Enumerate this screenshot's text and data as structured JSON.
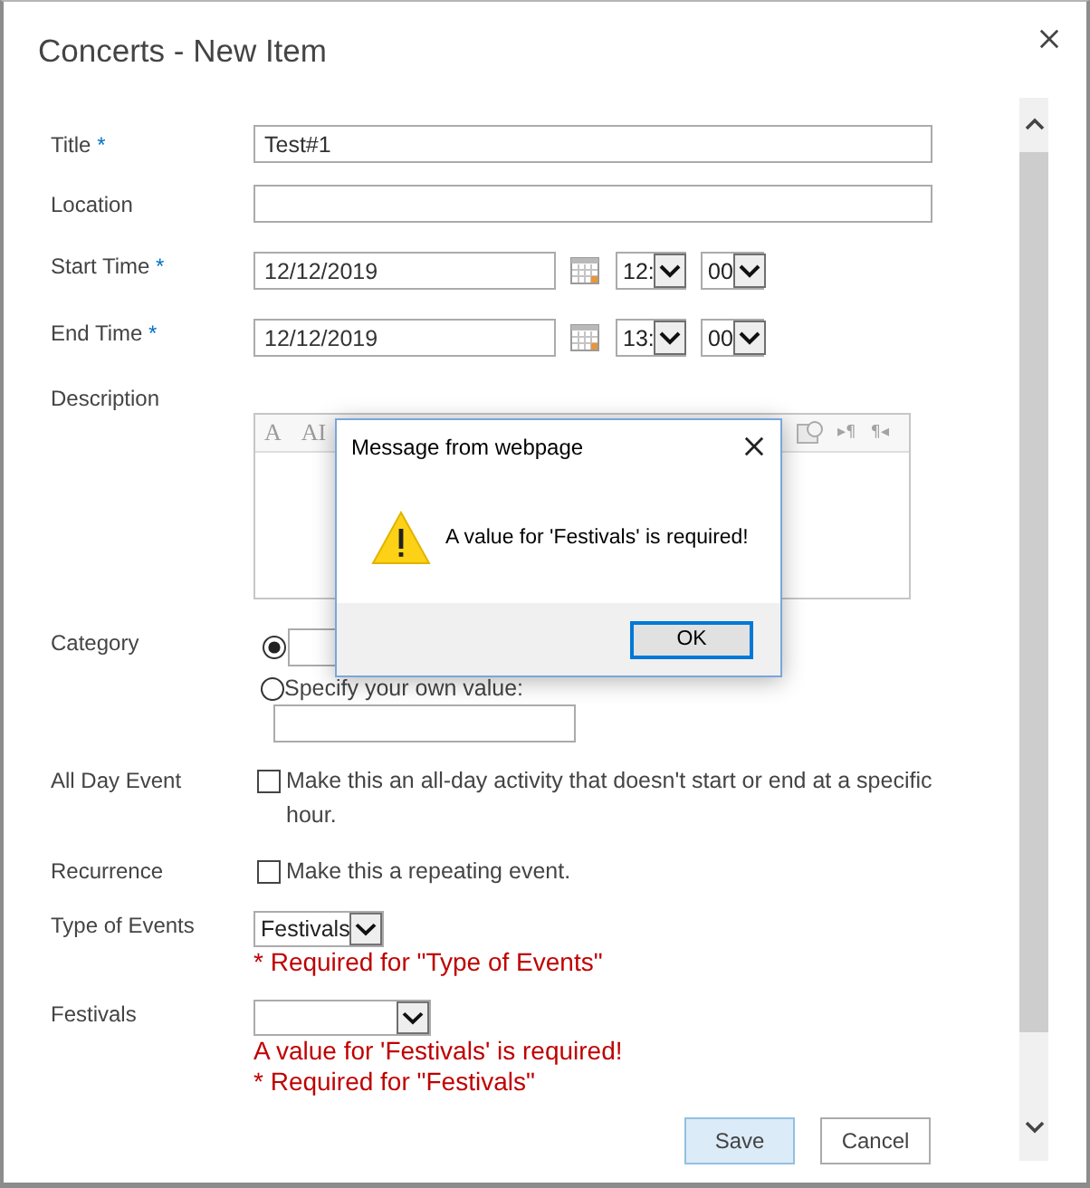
{
  "window": {
    "title": "Concerts - New Item"
  },
  "fields": [
    {
      "kind": "text",
      "label": "Title",
      "required_mark": "*",
      "value": "Test#1"
    },
    {
      "kind": "text",
      "label": "Location"
    },
    {
      "kind": "datetime",
      "label": "Start Time",
      "required_mark": "*",
      "date": "12/12/2019",
      "hour": "12:",
      "minute": "00"
    },
    {
      "kind": "datetime",
      "label": "End Time",
      "required_mark": "*",
      "date": "12/12/2019",
      "hour": "13:",
      "minute": "00"
    },
    {
      "kind": "richtext",
      "label": "Description",
      "toolbar_left": [
        "A",
        "AI"
      ],
      "toolbar_right": [
        "▸¶",
        "¶◂"
      ]
    },
    {
      "kind": "choice",
      "label": "Category",
      "options": [
        {
          "kind": "dropdown",
          "selected": true
        },
        {
          "kind": "custom",
          "label": "Specify your own value:",
          "selected": false
        }
      ]
    },
    {
      "kind": "checkbox",
      "label": "All Day Event",
      "text": "Make this an all-day activity that doesn't start or end at a specific hour.",
      "checked": false
    },
    {
      "kind": "checkbox",
      "label": "Recurrence",
      "text": "Make this a repeating event.",
      "checked": false
    },
    {
      "kind": "select",
      "label": "Type of Events",
      "value": "Festivals",
      "errors": [
        "* Required for \"Type of Events\""
      ]
    },
    {
      "kind": "select",
      "label": "Festivals",
      "errors": [
        "A value for 'Festivals' is required!",
        "* Required for \"Festivals\""
      ]
    }
  ],
  "buttons": [
    {
      "label": "Save",
      "focused": true
    },
    {
      "label": "Cancel",
      "focused": false
    }
  ],
  "message_box": {
    "title": "Message from webpage",
    "text": "A value for 'Festivals' is required!",
    "button": "OK"
  }
}
